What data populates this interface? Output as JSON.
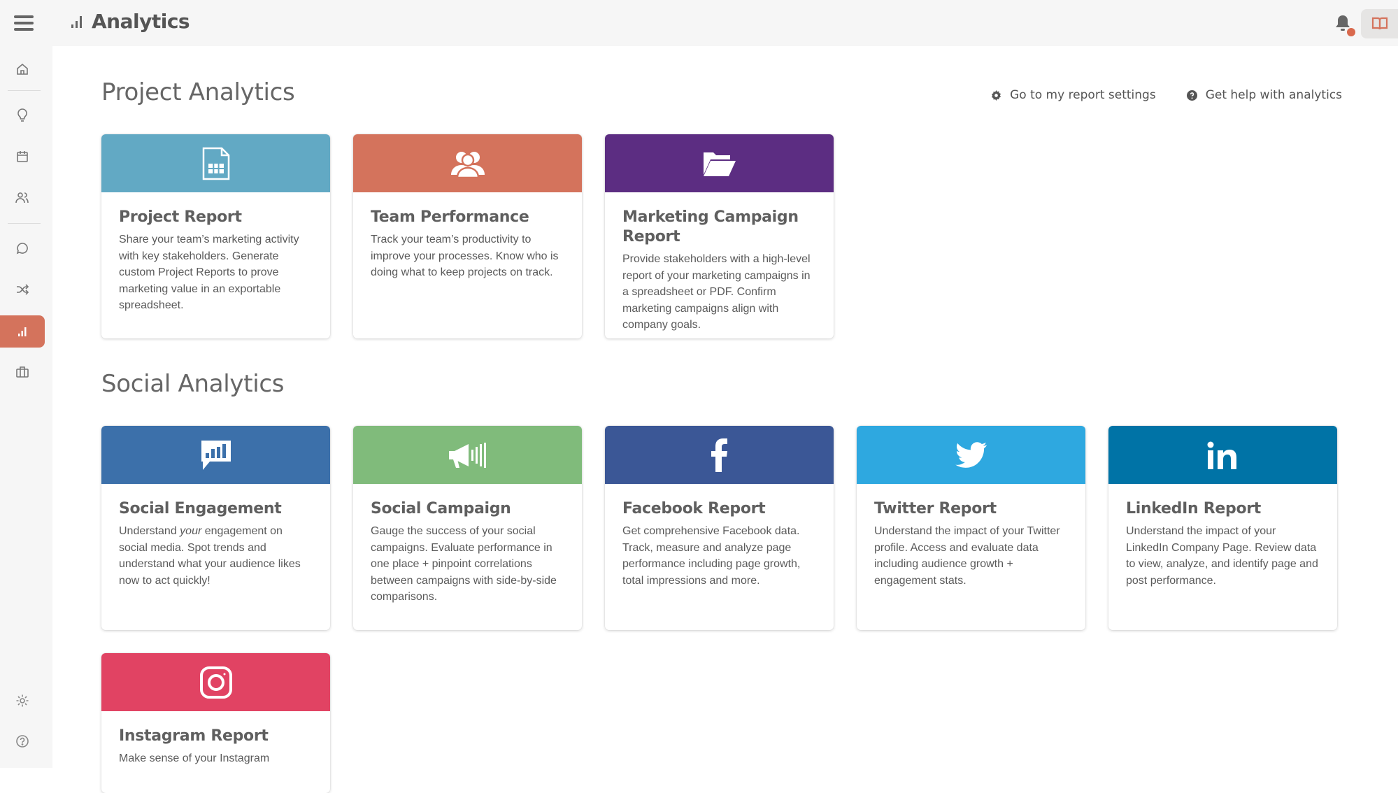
{
  "header": {
    "title": "Analytics",
    "menu_icon": "hamburger-menu-icon",
    "title_icon": "bar-chart-icon",
    "notification_icon": "bell-icon",
    "notification_badge_color": "#d9694d",
    "book_icon": "book-open-icon"
  },
  "sidebar": {
    "items": [
      {
        "icon": "home-icon",
        "active": false
      },
      {
        "icon": "lightbulb-icon",
        "active": false
      },
      {
        "icon": "calendar-icon",
        "active": false
      },
      {
        "icon": "users-icon",
        "active": false
      },
      {
        "icon": "chat-bubble-icon",
        "active": false
      },
      {
        "icon": "shuffle-icon",
        "active": false
      },
      {
        "icon": "analytics-icon",
        "active": true
      },
      {
        "icon": "briefcase-icon",
        "active": false
      }
    ],
    "bottom_items": [
      {
        "icon": "gear-icon"
      },
      {
        "icon": "help-circle-icon"
      }
    ],
    "active_color": "#d4735c"
  },
  "links": {
    "settings": {
      "label": "Go to my report settings",
      "icon": "gear-icon"
    },
    "help": {
      "label": "Get help with analytics",
      "icon": "question-circle-icon"
    }
  },
  "project_section": {
    "title": "Project Analytics",
    "cards": [
      {
        "title": "Project Report",
        "desc": "Share your team’s marketing activity with key stakeholders. Generate custom Project Reports to prove marketing value in an exportable spreadsheet.",
        "color": "#62a9c4",
        "icon": "spreadsheet-icon"
      },
      {
        "title": "Team Performance",
        "desc": "Track your team’s productivity to improve your processes. Know who is doing what to keep projects on track.",
        "color": "#d4735c",
        "icon": "team-icon"
      },
      {
        "title": "Marketing Campaign Report",
        "desc": "Provide stakeholders with a high-level report of your marketing campaigns in a spreadsheet or PDF. Confirm marketing campaigns align with company goals.",
        "color": "#5c2d82",
        "icon": "folder-open-icon"
      }
    ]
  },
  "social_section": {
    "title": "Social Analytics",
    "cards": [
      {
        "title": "Social Engagement",
        "desc_pre": "Understand ",
        "desc_em": "your",
        "desc_post": " engagement on social media. Spot trends and understand what your audience likes now to act quickly!",
        "color": "#3c70aa",
        "icon": "chat-chart-icon"
      },
      {
        "title": "Social Campaign",
        "desc": "Gauge the success of your social campaigns. Evaluate performance in one place + pinpoint correlations between campaigns with side-by-side comparisons.",
        "color": "#80bb7b",
        "icon": "megaphone-icon"
      },
      {
        "title": "Facebook Report",
        "desc": "Get comprehensive Facebook data. Track, measure and analyze page performance including page growth, total impressions and more.",
        "color": "#3b5796",
        "icon": "facebook-icon"
      },
      {
        "title": "Twitter Report",
        "desc": "Understand the impact of your Twitter profile. Access and evaluate data including audience growth + engagement stats.",
        "color": "#2ea8e0",
        "icon": "twitter-icon"
      },
      {
        "title": "LinkedIn Report",
        "desc": "Understand the impact of your LinkedIn Company Page. Review data to view, analyze, and identify page and post performance.",
        "color": "#0073a6",
        "icon": "linkedin-icon"
      },
      {
        "title": "Instagram Report",
        "desc": "Make sense of your Instagram",
        "color": "#e14363",
        "icon": "instagram-icon"
      }
    ]
  }
}
